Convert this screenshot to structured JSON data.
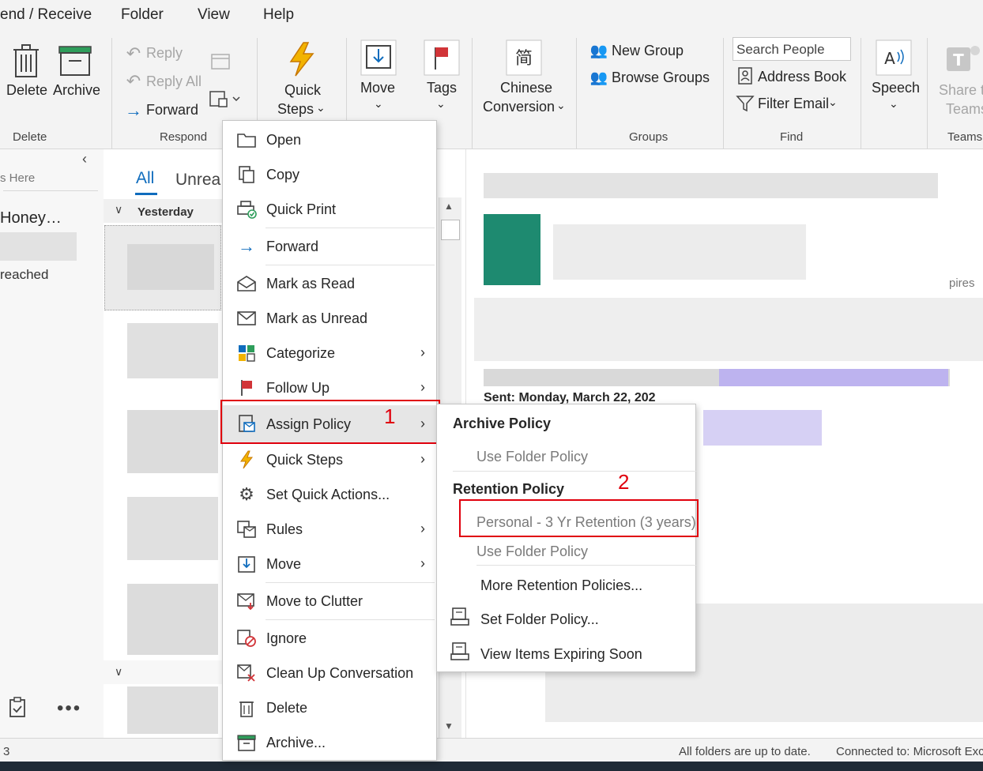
{
  "menu_tabs": [
    "end / Receive",
    "Folder",
    "View",
    "Help"
  ],
  "ribbon": {
    "delete_label": "Delete",
    "archive_label": "Archive",
    "reply_label": "Reply",
    "reply_all_label": "Reply All",
    "forward_label": "Forward",
    "quick_steps_label1": "Quick",
    "quick_steps_label2": "Steps",
    "move_label": "Move",
    "tags_label": "Tags",
    "chinese_label1": "Chinese",
    "chinese_label2": "Conversion",
    "new_group_label": "New Group",
    "browse_groups_label": "Browse Groups",
    "search_people_placeholder": "Search People",
    "address_book_label": "Address Book",
    "filter_email_label": "Filter Email",
    "speech_label": "Speech",
    "share_teams_label1": "Share t",
    "share_teams_label2": "Teams",
    "groups": {
      "delete": "Delete",
      "respond": "Respond",
      "groups": "Groups",
      "find": "Find",
      "teams": "Teams"
    }
  },
  "leftnav": {
    "drop_hint": "s Here",
    "folder_name": "Honey…",
    "reached": "reached"
  },
  "msglist": {
    "tab_all": "All",
    "tab_unread": "Unrea",
    "group_yesterday": "Yesterday"
  },
  "reading": {
    "expires_fragment": "pires",
    "sent_fragment": "Sent: Monday, March 22, 202"
  },
  "context_menu": {
    "items": [
      {
        "label": "Open"
      },
      {
        "label": "Copy"
      },
      {
        "label": "Quick Print"
      },
      {
        "label": "Forward"
      },
      {
        "label": "Mark as Read"
      },
      {
        "label": "Mark as Unread"
      },
      {
        "label": "Categorize"
      },
      {
        "label": "Follow Up"
      },
      {
        "label": "Assign Policy"
      },
      {
        "label": "Quick Steps"
      },
      {
        "label": "Set Quick Actions..."
      },
      {
        "label": "Rules"
      },
      {
        "label": "Move"
      },
      {
        "label": "Move to Clutter"
      },
      {
        "label": "Ignore"
      },
      {
        "label": "Clean Up Conversation"
      },
      {
        "label": "Delete"
      },
      {
        "label": "Archive..."
      }
    ]
  },
  "submenu": {
    "archive_header": "Archive Policy",
    "archive_use_folder": "Use Folder Policy",
    "retention_header": "Retention Policy",
    "retention_personal": "Personal - 3 Yr Retention (3 years)",
    "retention_use_folder": "Use Folder Policy",
    "more_policies": "More Retention Policies...",
    "set_folder_policy": "Set Folder Policy...",
    "view_expiring": "View Items Expiring Soon"
  },
  "annotations": {
    "marker_1": "1",
    "marker_2": "2"
  },
  "status": {
    "left_count": "3",
    "folders_status": "All folders are up to date.",
    "connected": "Connected to: Microsoft Exc"
  },
  "colors": {
    "accent_blue": "#0f6cbd",
    "annotation_red": "#e0000d",
    "flag_red": "#d13438",
    "quick_steps_yellow": "#f2b300"
  }
}
